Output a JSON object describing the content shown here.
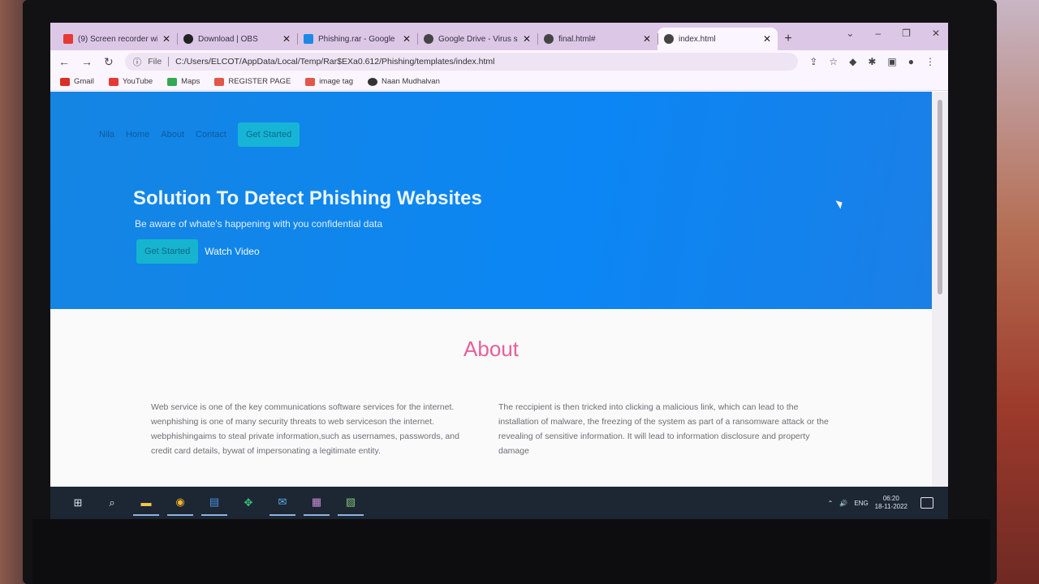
{
  "browser": {
    "tabs": [
      {
        "label": "(9) Screen recorder wi",
        "favicon_color": "#e53935",
        "active": false
      },
      {
        "label": "Download | OBS",
        "favicon_color": "#222222",
        "active": false
      },
      {
        "label": "Phishing.rar - Google",
        "favicon_color": "#1e88e5",
        "active": false
      },
      {
        "label": "Google Drive - Virus s",
        "favicon_color": "#444444",
        "active": false
      },
      {
        "label": "final.html#",
        "favicon_color": "#444444",
        "active": false
      },
      {
        "label": "index.html",
        "favicon_color": "#444444",
        "active": true
      }
    ],
    "new_tab_label": "+",
    "address": {
      "scheme": "File",
      "url": "C:/Users/ELCOT/AppData/Local/Temp/Rar$EXa0.612/Phishing/templates/index.html"
    },
    "bookmarks": [
      {
        "label": "Gmail",
        "icon": "gmail-icon",
        "color": "#d93025"
      },
      {
        "label": "YouTube",
        "icon": "youtube-icon",
        "color": "#e53935"
      },
      {
        "label": "Maps",
        "icon": "maps-icon",
        "color": "#34a853"
      },
      {
        "label": "REGISTER PAGE",
        "icon": "page-icon",
        "color": "#e0584a"
      },
      {
        "label": "image tag",
        "icon": "page-icon",
        "color": "#e0584a"
      },
      {
        "label": "Naan Mudhalvan",
        "icon": "globe-icon",
        "color": "#333333"
      }
    ]
  },
  "site": {
    "nav": {
      "brand": "Nila",
      "links": [
        "Home",
        "About",
        "Contact"
      ],
      "cta": "Get Started"
    },
    "hero": {
      "title": "Solution To Detect Phishing Websites",
      "subtitle": "Be aware of whate's happening with you confidential data",
      "primary_button": "Get Started",
      "secondary_link": "Watch Video"
    },
    "about": {
      "heading": "About",
      "left_text": "Web service is one of the key communications software services for the internet. wenphishing is one of many security threats to web serviceson the internet. webphishingaims to steal private information,such as usernames, passwords, and credit card details, bywat of impersonating a legitimate entity.",
      "right_text": "The reccipient is then tricked into clicking a malicious link, which can lead to the installation of malware, the freezing of the system as part of a ransomware attack or the revealing of sensitive information. It will lead to information disclosure and property damage"
    }
  },
  "taskbar": {
    "tray_lang": "ENG",
    "time": "06:20",
    "date": "18-11-2022"
  }
}
